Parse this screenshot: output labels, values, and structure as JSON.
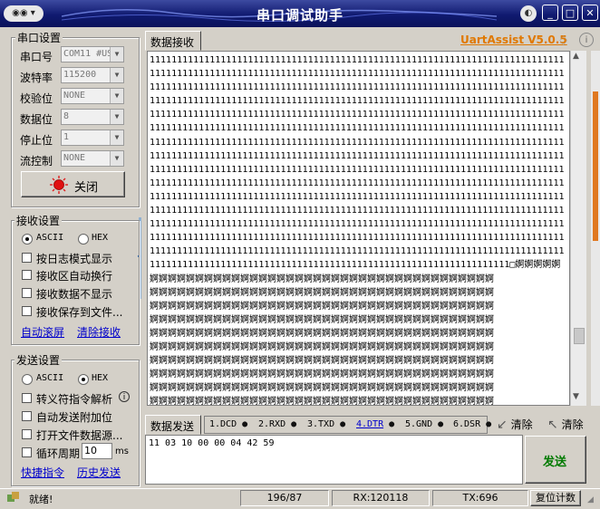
{
  "window": {
    "title": "串口调试助手"
  },
  "serial_settings": {
    "title": "串口设置",
    "fields": [
      {
        "label": "串口号",
        "value": "COM11 #US"
      },
      {
        "label": "波特率",
        "value": "115200"
      },
      {
        "label": "校验位",
        "value": "NONE"
      },
      {
        "label": "数据位",
        "value": "8"
      },
      {
        "label": "停止位",
        "value": "1"
      },
      {
        "label": "流控制",
        "value": "NONE"
      }
    ],
    "close_button": "关闭"
  },
  "receive_settings": {
    "title": "接收设置",
    "ascii": "ASCII",
    "hex": "HEX",
    "selected": "ASCII",
    "options": [
      "按日志模式显示",
      "接收区自动换行",
      "接收数据不显示",
      "接收保存到文件..."
    ],
    "auto_scroll": "自动滚屏",
    "clear_receive": "清除接收"
  },
  "send_settings": {
    "title": "发送设置",
    "ascii": "ASCII",
    "hex": "HEX",
    "selected": "HEX",
    "options": [
      "转义符指令解析",
      "自动发送附加位",
      "打开文件数据源...",
      "循环周期"
    ],
    "period_value": "10",
    "period_unit": "ms",
    "shortcut": "快捷指令",
    "history": "历史发送"
  },
  "receive_tab": {
    "label": "数据接收"
  },
  "brand": {
    "name": "UartAssist V5.0.5",
    "color": "#e07800"
  },
  "receive_content": {
    "ones_line": "1111111111111111111111111111111111111111111111111111111111111111111111111111",
    "last_ones_line": "111111111111111111111111111111111111111111111111111111111111111111□婀婀婀婀婀",
    "a_line": "婀婀婀婀婀婀婀婀婀婀婀婀婀婀婀婀婀婀婀婀婀婀婀婀婀婀婀婀婀婀婀婀婀婀婀婀婀婀",
    "ones_count": 15,
    "a_count": 10
  },
  "send_tab": {
    "label": "数据发送",
    "signals": [
      {
        "label": "1.DCD",
        "link": false
      },
      {
        "label": "2.RXD",
        "link": false
      },
      {
        "label": "3.TXD",
        "link": false
      },
      {
        "label": "4.DTR",
        "link": true
      },
      {
        "label": "5.GND",
        "link": false
      },
      {
        "label": "6.DSR",
        "link": false
      }
    ],
    "clear_left": "清除",
    "clear_right": "清除"
  },
  "send_content": "11 03 10 00 00 04 42 59",
  "send_button": "发送",
  "status_bar": {
    "status": "就绪!",
    "count": "196/87",
    "rx": "RX:120118",
    "tx": "TX:696",
    "reset": "复位计数"
  }
}
